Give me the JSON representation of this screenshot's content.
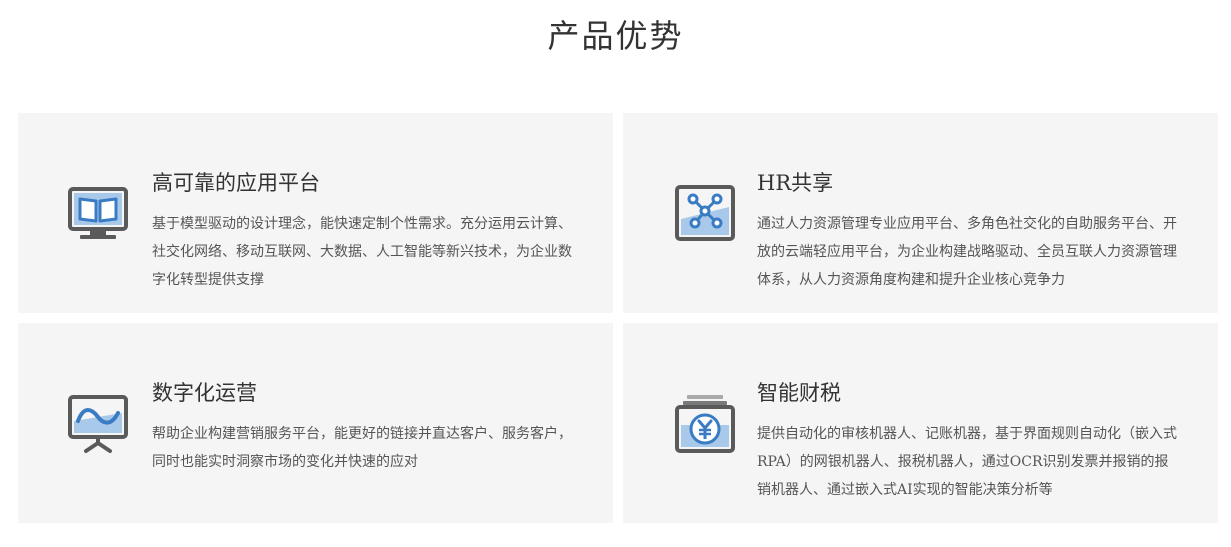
{
  "section": {
    "title": "产品优势"
  },
  "cards": [
    {
      "title": "高可靠的应用平台",
      "description": "基于模型驱动的设计理念，能快速定制个性需求。充分运用云计算、社交化网络、移动互联网、大数据、人工智能等新兴技术，为企业数字化转型提供支撑",
      "icon": "monitor-book-icon"
    },
    {
      "title": "HR共享",
      "description": "通过人力资源管理专业应用平台、多角色社交化的自助服务平台、开放的云端轻应用平台，为企业构建战略驱动、全员互联人力资源管理体系，从人力资源角度构建和提升企业核心竞争力",
      "icon": "network-share-icon"
    },
    {
      "title": "数字化运营",
      "description": "帮助企业构建营销服务平台，能更好的链接并直达客户、服务客户，同时也能实时洞察市场的变化并快速的应对",
      "icon": "presentation-board-icon"
    },
    {
      "title": "智能财税",
      "description": "提供自动化的审核机器人、记账机器，基于界面规则自动化（嵌入式RPA）的网银机器人、报税机器人，通过OCR识别发票并报销的报销机器人、通过嵌入式AI实现的智能决策分析等",
      "icon": "yuan-stack-icon"
    }
  ],
  "colors": {
    "icon_gray": "#5a5a5a",
    "icon_blue": "#3a7cc4",
    "icon_light_blue": "#a9c9ea",
    "card_bg": "#f5f5f5"
  }
}
